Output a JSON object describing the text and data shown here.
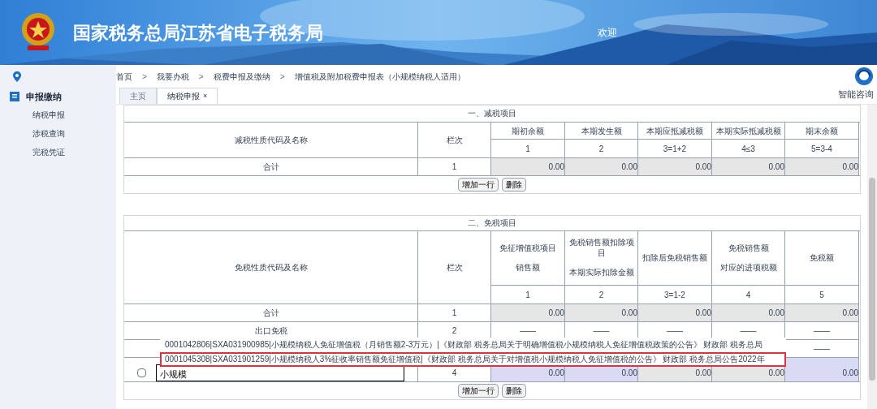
{
  "header": {
    "title": "国家税务总局江苏省电子税务局",
    "welcome": "欢迎"
  },
  "breadcrumb_separator": ">",
  "breadcrumb": [
    "首页",
    "我要办税",
    "税费申报及缴纳",
    "增值税及附加税费申报表（小规模纳税人适用）"
  ],
  "help": {
    "label": "智能咨询"
  },
  "sidebar": {
    "section": "申报缴纳",
    "items": [
      {
        "label": "纳税申报",
        "selected": false
      },
      {
        "label": "涉税查询",
        "selected": false
      },
      {
        "label": "完税凭证",
        "selected": false
      }
    ]
  },
  "tabs": [
    {
      "label": "主页",
      "selected": false,
      "closable": false
    },
    {
      "label": "纳税申报",
      "selected": true,
      "closable": true
    }
  ],
  "close_glyph": "×",
  "reduction": {
    "title": "一、减税项目",
    "name_header": "减税性质代码及名称",
    "line_header": "栏次",
    "columns": [
      {
        "label": "期初余额",
        "number": "1"
      },
      {
        "label": "本期发生额",
        "number": "2"
      },
      {
        "label": "本期应抵减税额",
        "number": "3=1+2"
      },
      {
        "label": "本期实际抵减税额",
        "number": "4≤3"
      },
      {
        "label": "期末余额",
        "number": "5=3-4"
      }
    ],
    "rows": [
      {
        "label": "合计",
        "line": "1",
        "values": [
          "0.00",
          "0.00",
          "0.00",
          "0.00",
          "0.00"
        ]
      }
    ],
    "buttons": [
      "增加一行",
      "删除"
    ]
  },
  "exemption": {
    "title": "二、免税项目",
    "name_header": "免税性质代码及名称",
    "line_header": "栏次",
    "columns": [
      {
        "label": [
          "免征增值税项目",
          "销售额"
        ],
        "number": "1"
      },
      {
        "label": [
          "免税销售额扣除项目",
          "本期实际扣除金额"
        ],
        "number": "2"
      },
      {
        "label": [
          "扣除后免税销售额"
        ],
        "number": "3=1-2"
      },
      {
        "label": [
          "免税销售额",
          "对应的进项税额"
        ],
        "number": "4"
      },
      {
        "label": [
          "免税额"
        ],
        "number": "5"
      }
    ],
    "rows": [
      {
        "kind": "total",
        "label": "合计",
        "line": "1",
        "values": [
          "0.00",
          "0.00",
          "0.00",
          "0.00",
          "0.00"
        ]
      },
      {
        "kind": "fixed",
        "label": "出口免税",
        "line": "2",
        "values": [
          "——",
          "——",
          "——",
          "——",
          "——"
        ]
      },
      {
        "kind": "fixed",
        "values": [
          "——"
        ]
      },
      {
        "kind": "input",
        "checked": false,
        "value": "小规模",
        "line": "4",
        "values": [
          "0.00",
          "0.00",
          "0.00",
          "0.00",
          "0.00"
        ]
      }
    ],
    "dropdown": [
      {
        "label": "0001042806|SXA031900985|小规模纳税人免征增值税（月销售额2-3万元）|《财政部 税务总局关于明确增值税小规模纳税人免征增值税政策的公告》 财政部 税务总局",
        "selected": false
      },
      {
        "label": "0001045308|SXA031901259|小规模纳税人3%征收率销售额免征增值税|《财政部 税务总局关于对增值税小规模纳税人免征增值税的公告》 财政部 税务总局公告2022年",
        "selected": true
      }
    ],
    "buttons": [
      "增加一行",
      "删除"
    ]
  }
}
